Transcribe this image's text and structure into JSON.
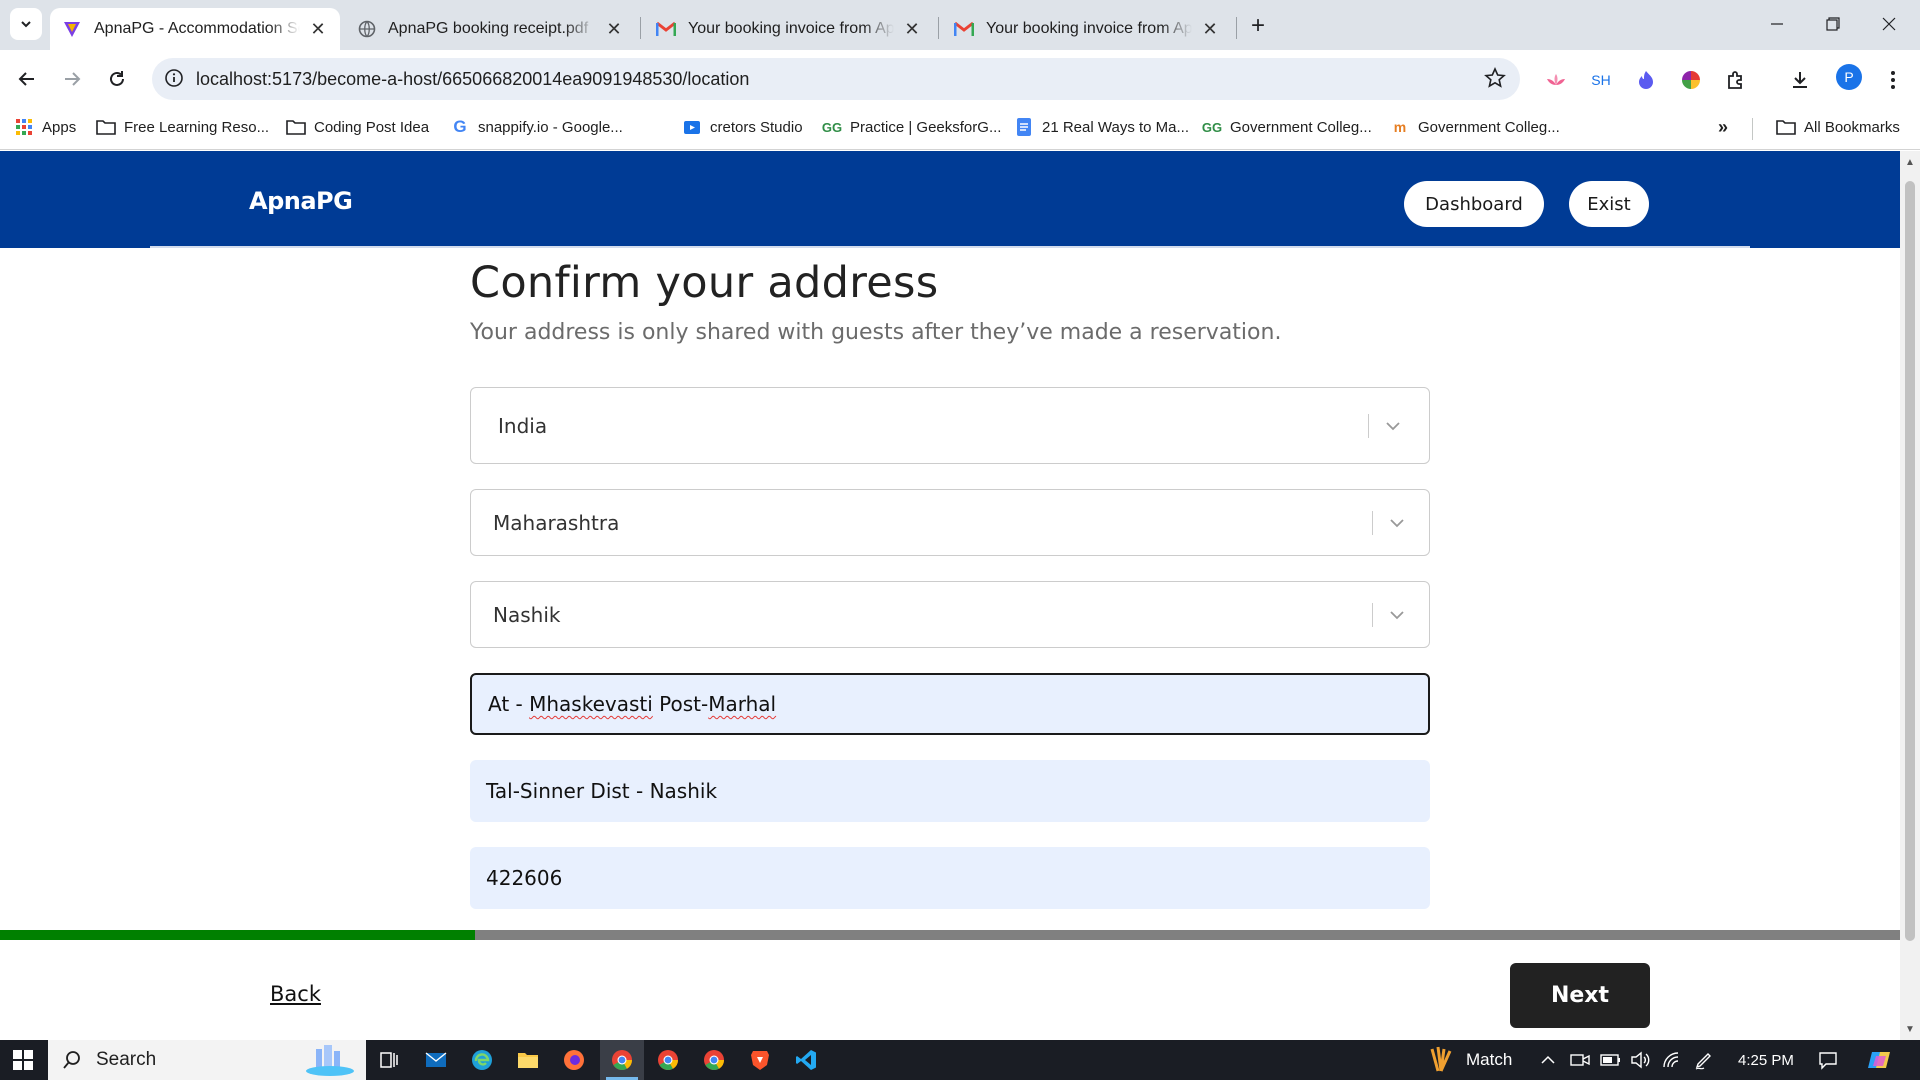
{
  "browser": {
    "tabs": [
      {
        "title": "ApnaPG - Accommodation Solu",
        "icon": "apnapg-favicon",
        "active": true
      },
      {
        "title": "ApnaPG booking receipt.pdf",
        "icon": "globe-icon",
        "active": false
      },
      {
        "title": "Your booking invoice from Apn",
        "icon": "gmail-icon",
        "active": false
      },
      {
        "title": "Your booking invoice from Apn",
        "icon": "gmail-icon",
        "active": false
      }
    ],
    "url": "localhost:5173/become-a-host/665066820014ea9091948530/location",
    "extensions": [
      "SH"
    ],
    "profile_initial": "P",
    "bookmarks": [
      {
        "label": "Apps",
        "icon": "apps-grid-icon"
      },
      {
        "label": "Free Learning Reso...",
        "icon": "folder-icon"
      },
      {
        "label": "Coding Post Idea",
        "icon": "folder-icon"
      },
      {
        "label": "snappify.io - Google...",
        "icon": "google-icon"
      },
      {
        "label": "cretors Studio",
        "icon": "studio-icon"
      },
      {
        "label": "Practice | GeeksforG...",
        "icon": "gfg-icon"
      },
      {
        "label": "21 Real Ways to Ma...",
        "icon": "docs-icon"
      },
      {
        "label": "Government Colleg...",
        "icon": "gfg-icon"
      },
      {
        "label": "Government Colleg...",
        "icon": "college-icon"
      }
    ],
    "all_bookmarks_label": "All Bookmarks"
  },
  "header": {
    "brand": "ApnaPG",
    "dashboard_label": "Dashboard",
    "exit_label": "Exist"
  },
  "form": {
    "title": "Confirm your address",
    "subtitle": "Your address is only shared with guests after they’ve made a reservation.",
    "country": "India",
    "state": "Maharashtra",
    "city": "Nashik",
    "address_line1_prefix": "At - ",
    "address_line1_word1": "Mhaskevasti",
    "address_line1_mid": " Post-",
    "address_line1_word2": "Marhal",
    "address_line2": "Tal-Sinner Dist - Nashik",
    "pincode": "422606"
  },
  "progress": {
    "fraction": 0.25
  },
  "footer": {
    "back_label": "Back",
    "next_label": "Next"
  },
  "taskbar": {
    "search_label": "Search",
    "weather_label": "Match",
    "time": "4:25 PM"
  },
  "colors": {
    "header_bg": "#003b95",
    "progress_fill": "#008000",
    "progress_track": "#808080",
    "next_bg": "#222222",
    "autofill_bg": "#e8f0fe"
  }
}
